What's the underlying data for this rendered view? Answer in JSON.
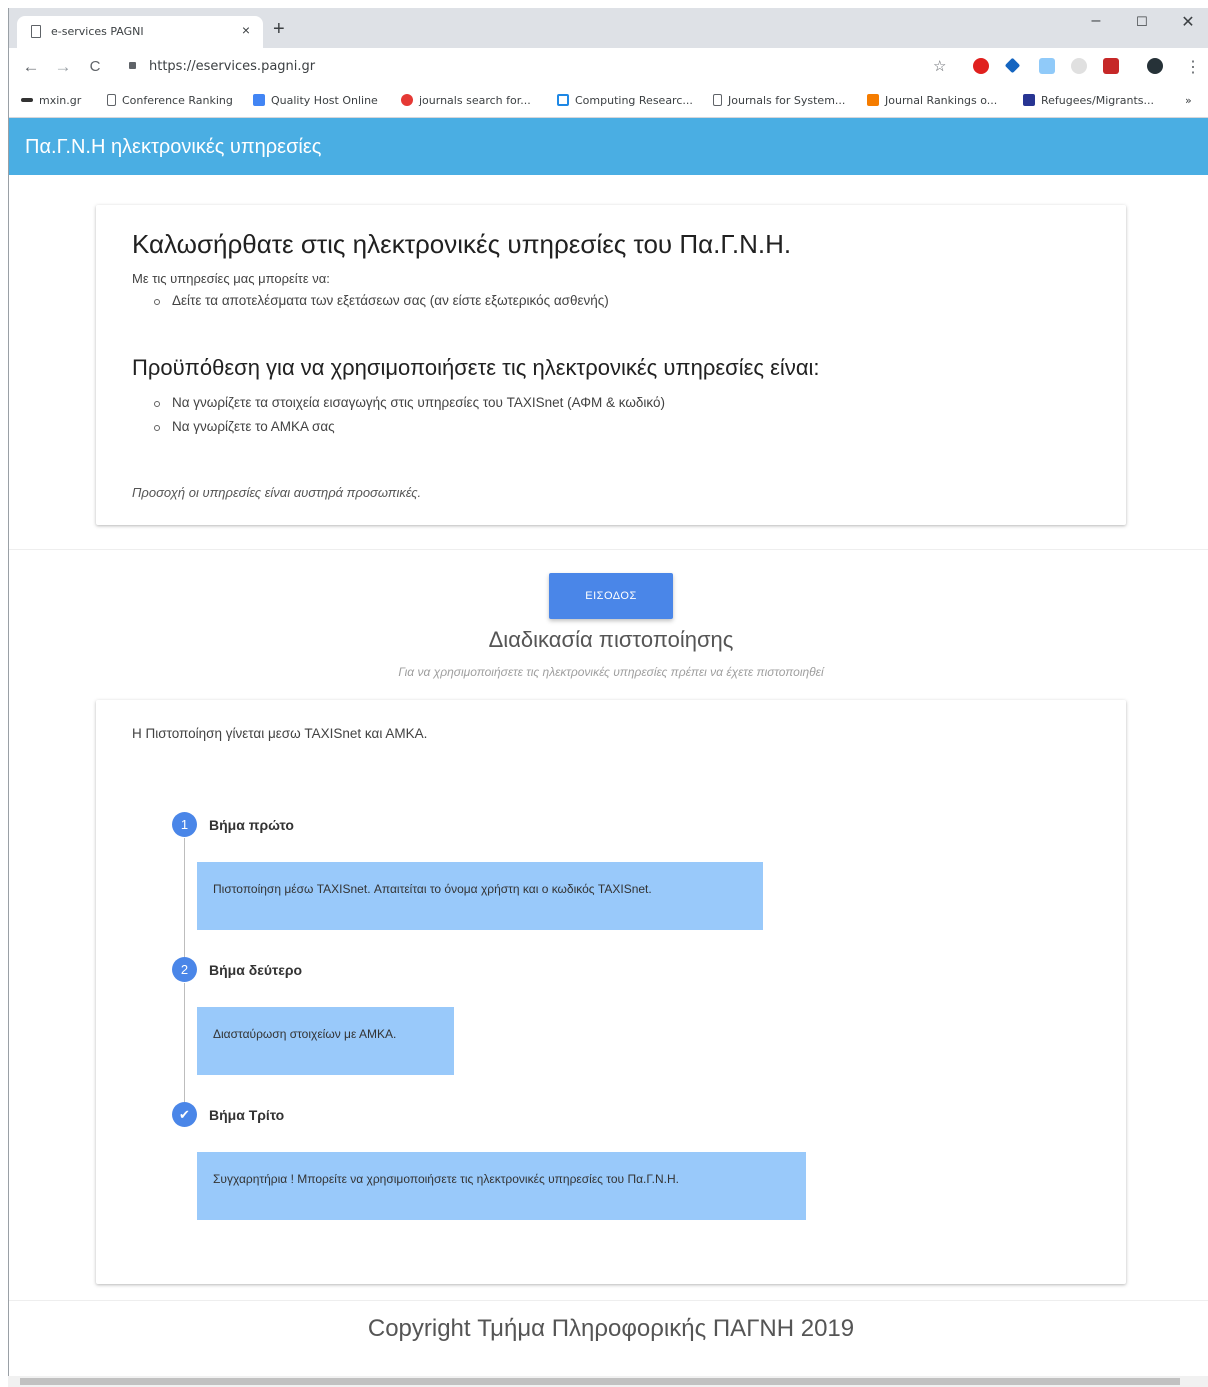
{
  "browser": {
    "tab_title": "e-services PAGNI",
    "tab_close": "×",
    "new_tab": "+",
    "url": "https://eservices.pagni.gr",
    "window_controls": {
      "minimize": "–",
      "maximize": "☐",
      "close": "✕"
    },
    "nav": {
      "back": "←",
      "forward": "→",
      "reload": "C"
    },
    "bookmarks": [
      {
        "label": "mxin.gr",
        "icon": "site-icon",
        "color": "#333333"
      },
      {
        "label": "Conference Ranking",
        "icon": "page-icon",
        "color": "#ffffff"
      },
      {
        "label": "Quality Host Online",
        "icon": "site-icon",
        "color": "#4285f4"
      },
      {
        "label": "journals search for...",
        "icon": "site-icon",
        "color": "#e53935"
      },
      {
        "label": "Computing Researc...",
        "icon": "site-icon",
        "color": "#1e88e5"
      },
      {
        "label": "Journals for System...",
        "icon": "page-icon",
        "color": "#ffffff"
      },
      {
        "label": "Journal Rankings o...",
        "icon": "site-icon",
        "color": "#f57c00"
      },
      {
        "label": "Refugees/Migrants...",
        "icon": "site-icon",
        "color": "#283593"
      }
    ],
    "bookmarks_more": "»"
  },
  "appbar": {
    "title": "Πα.Γ.Ν.Η ηλεκτρονικές υπηρεσίες"
  },
  "welcome": {
    "heading": "Καλωσήρθατε στις ηλεκτρονικές υπηρεσίες του Πα.Γ.Ν.Η.",
    "intro": "Με τις υπηρεσίες μας μπορείτε να:",
    "services": [
      "Δείτε τα αποτελέσματα των εξετάσεων σας (αν είστε εξωτερικός ασθενής)"
    ],
    "prereq_heading": "Προϋπόθεση για να χρησιμοποιήσετε τις ηλεκτρονικές υπηρεσίες είναι:",
    "prereqs": [
      "Να γνωρίζετε τα στοιχεία εισαγωγής στις υπηρεσίες του TAXISnet (ΑΦΜ & κωδικό)",
      "Να γνωρίζετε το ΑΜΚΑ σας"
    ],
    "notice": "Προσοχή οι υπηρεσίες είναι αυστηρά προσωπικές."
  },
  "login": {
    "button_label": "ΕΙΣΟΔΟΣ"
  },
  "auth": {
    "title": "Διαδικασία πιστοποίησης",
    "subtitle": "Για να χρησιμοποιήσετε τις ηλεκτρονικές υπηρεσίες πρέπει να έχετε πιστοποιηθεί",
    "lead": "Η Πιστοποίηση γίνεται μεσω TAXISnet και ΑΜΚΑ.",
    "steps": [
      {
        "marker": "1",
        "label": "Βήμα πρώτο",
        "text": "Πιστοποίηση μέσω TAXISnet. Απαιτείται το όνομα χρήστη και ο κωδικός TAXISnet."
      },
      {
        "marker": "2",
        "label": "Βήμα δεύτερο",
        "text": "Διασταύρωση στοιχείων με ΑΜΚΑ."
      },
      {
        "marker": "✔",
        "label": "Βήμα Τρίτο",
        "text": "Συγχαρητήρια ! Μπορείτε να χρησιμοποιήσετε τις ηλεκτρονικές υπηρεσίες του Πα.Γ.Ν.Η."
      }
    ]
  },
  "footer": {
    "copyright": "Copyright Τμήμα Πληροφορικής ΠΑΓΝΗ 2019"
  },
  "colors": {
    "appbar": "#4aaee3",
    "accent": "#4a86e8",
    "step_box": "#99c9fa"
  }
}
